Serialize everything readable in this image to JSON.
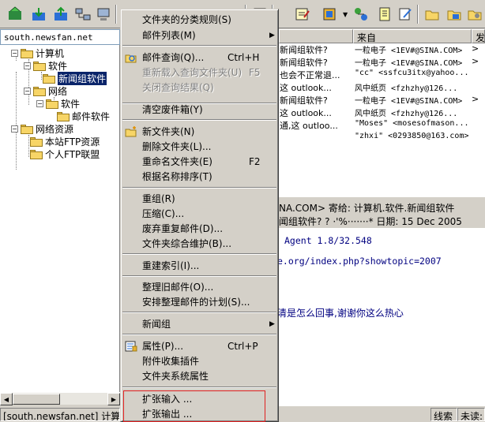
{
  "toolbar": {
    "icons": [
      "send-receive-icon",
      "receive-icon",
      "send-icon",
      "connect-icon",
      "disconnect-icon",
      "print-icon",
      "reply-icon",
      "dropdown-arrow",
      "properties-icon",
      "note-icon",
      "edit-note-icon",
      "new-folder-icon",
      "open-folder-icon",
      "folder-settings-icon"
    ]
  },
  "server_box": {
    "value": "south.newsfan.net"
  },
  "tree": {
    "items": [
      {
        "label": "计算机"
      },
      {
        "label": "软件"
      },
      {
        "label": "新闻组软件"
      },
      {
        "label": "网络"
      },
      {
        "label": "软件"
      },
      {
        "label": "邮件软件"
      },
      {
        "label": "网络资源"
      },
      {
        "label": "本站FTP资源"
      },
      {
        "label": "个人FTP联盟"
      }
    ]
  },
  "list": {
    "headers": [
      "来自",
      "发"
    ],
    "rows": [
      {
        "subject": "新闻组软件?",
        "from": "一粒电子 <1EV#@SINA.COM>",
        "date": ">"
      },
      {
        "subject": "新闻组软件?",
        "from": "一粒电子 <1EV#@SINA.COM>",
        "date": ">"
      },
      {
        "subject": "也会不正常退...",
        "from": "\"cc\" <ssfcu3itx@yahoo...",
        "date": ""
      },
      {
        "subject": "这 outlook...",
        "from": "风中纸页 <fzhzhy@126...",
        "date": ""
      },
      {
        "subject": "新闻组软件?",
        "from": "一粒电子 <1EV#@SINA.COM>",
        "date": ">"
      },
      {
        "subject": "这 outlook...",
        "from": "风中纸页 <fzhzhy@126...",
        "date": ""
      },
      {
        "subject": "通,这 outloo...",
        "from": "\"Moses\" <mosesofmason...",
        "date": ""
      },
      {
        "subject": "",
        "from": "\"zhxi\" <0293850@163.com>",
        "date": ""
      }
    ]
  },
  "preview": {
    "header_line1": "NA.COM>  寄给: 计算机.软件.新闻组软件",
    "header_line2": "闻组软件? ? ·'%·······*  日期: 15 Dec 2005",
    "lines": [
      "Agent 1.8/32.548",
      "e.org/index.php?showtopic=2007",
      "清是怎么回事,谢谢你这么热心"
    ]
  },
  "status": {
    "left": "[south.newsfan.net] 计算机",
    "middle": "线索",
    "right": "未读:"
  },
  "context_menu": {
    "items": [
      {
        "label": "文件夹的分类规则(S)",
        "shortcut": "",
        "submenu": false,
        "disabled": false
      },
      {
        "label": "邮件列表(M)",
        "shortcut": "",
        "submenu": true,
        "disabled": false
      },
      {
        "label": "邮件查询(Q)...",
        "shortcut": "Ctrl+H",
        "submenu": false,
        "disabled": false
      },
      {
        "label": "重新载入查询文件夹(U)",
        "shortcut": "F5",
        "submenu": false,
        "disabled": true
      },
      {
        "label": "关闭查询结果(Q)",
        "shortcut": "",
        "submenu": false,
        "disabled": true
      },
      {
        "label": "清空废件箱(Y)",
        "shortcut": "",
        "submenu": false,
        "disabled": false
      },
      {
        "label": "新文件夹(N)",
        "shortcut": "",
        "submenu": false,
        "disabled": false
      },
      {
        "label": "删除文件夹(L)...",
        "shortcut": "",
        "submenu": false,
        "disabled": false
      },
      {
        "label": "重命名文件夹(E)",
        "shortcut": "F2",
        "submenu": false,
        "disabled": false
      },
      {
        "label": "根据名称排序(T)",
        "shortcut": "",
        "submenu": false,
        "disabled": false
      },
      {
        "label": "重组(R)",
        "shortcut": "",
        "submenu": false,
        "disabled": false
      },
      {
        "label": "压缩(C)...",
        "shortcut": "",
        "submenu": false,
        "disabled": false
      },
      {
        "label": "废弃重复邮件(D)...",
        "shortcut": "",
        "submenu": false,
        "disabled": false
      },
      {
        "label": "文件夹综合维护(B)...",
        "shortcut": "",
        "submenu": false,
        "disabled": false
      },
      {
        "label": "重建索引(I)...",
        "shortcut": "",
        "submenu": false,
        "disabled": false
      },
      {
        "label": "整理旧邮件(O)...",
        "shortcut": "",
        "submenu": false,
        "disabled": false
      },
      {
        "label": "安排整理邮件的计划(S)...",
        "shortcut": "",
        "submenu": false,
        "disabled": false
      },
      {
        "label": "新闻组",
        "shortcut": "",
        "submenu": true,
        "disabled": false
      },
      {
        "label": "属性(P)...",
        "shortcut": "Ctrl+P",
        "submenu": false,
        "disabled": false
      },
      {
        "label": "附件收集插件",
        "shortcut": "",
        "submenu": false,
        "disabled": false
      },
      {
        "label": "文件夹系统属性",
        "shortcut": "",
        "submenu": false,
        "disabled": false
      },
      {
        "label": "扩张输入 ...",
        "shortcut": "",
        "submenu": false,
        "disabled": false
      },
      {
        "label": "扩张输出 ...",
        "shortcut": "",
        "submenu": false,
        "disabled": false
      }
    ]
  }
}
